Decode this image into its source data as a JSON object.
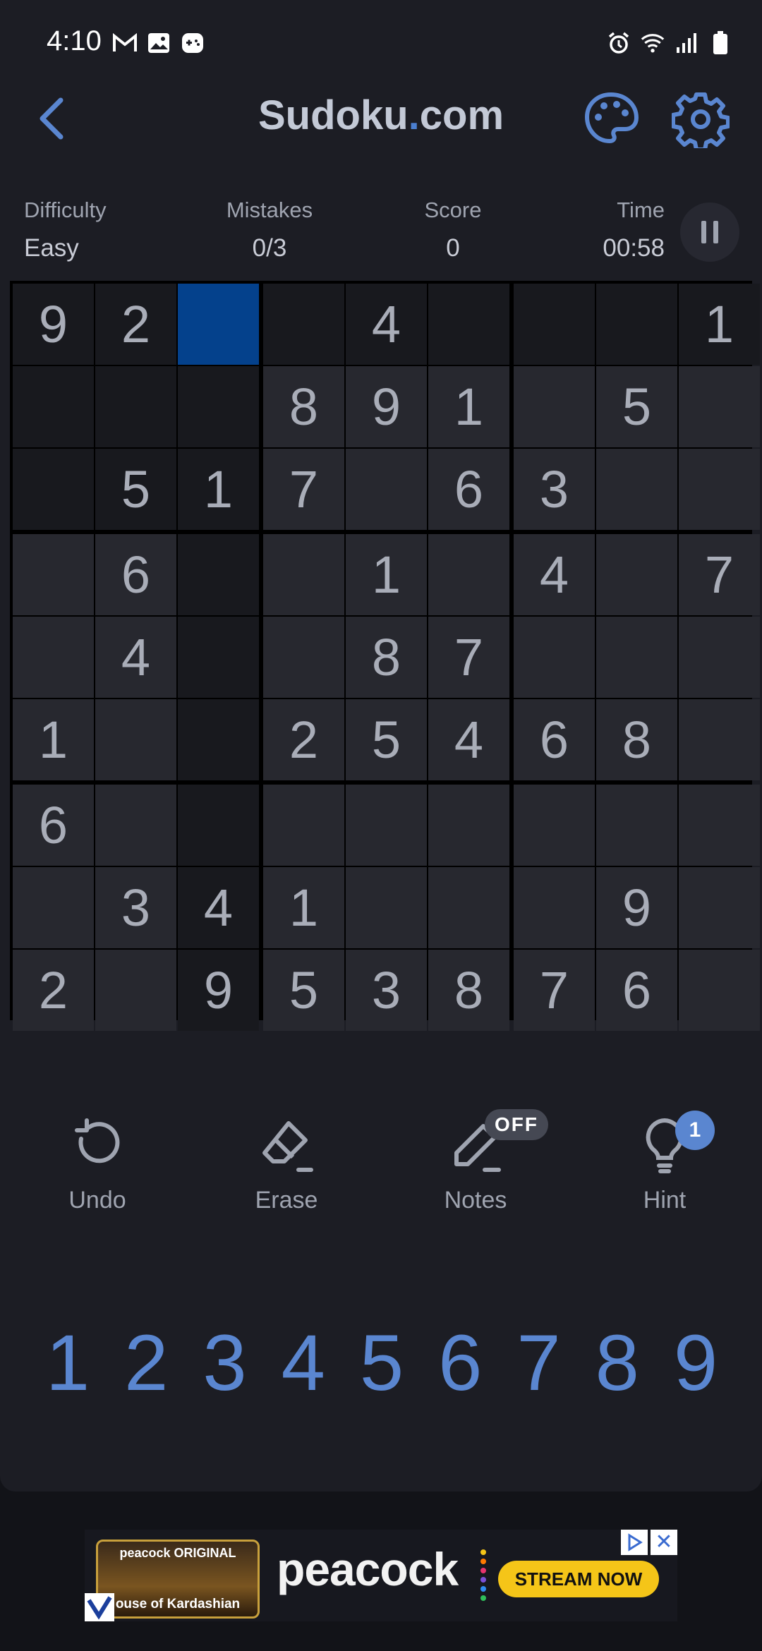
{
  "status_bar": {
    "time": "4:10",
    "left_icons": [
      "gmail-icon",
      "gallery-icon",
      "game-icon"
    ],
    "right_icons": [
      "alarm-icon",
      "wifi-icon",
      "signal-icon",
      "battery-icon"
    ]
  },
  "header": {
    "title_main": "Sudoku",
    "title_dot": ".",
    "title_tld": "com"
  },
  "stats": {
    "difficulty": {
      "label": "Difficulty",
      "value": "Easy"
    },
    "mistakes": {
      "label": "Mistakes",
      "value": "0/3"
    },
    "score": {
      "label": "Score",
      "value": "0"
    },
    "time": {
      "label": "Time",
      "value": "00:58"
    }
  },
  "grid": {
    "selected": [
      0,
      2
    ],
    "rows": [
      [
        "9",
        "2",
        "",
        "",
        "4",
        "",
        "",
        "",
        "1"
      ],
      [
        "",
        "",
        "",
        "8",
        "9",
        "1",
        "",
        "5",
        ""
      ],
      [
        "",
        "5",
        "1",
        "7",
        "",
        "6",
        "3",
        "",
        ""
      ],
      [
        "",
        "6",
        "",
        "",
        "1",
        "",
        "4",
        "",
        "7"
      ],
      [
        "",
        "4",
        "",
        "",
        "8",
        "7",
        "",
        "",
        ""
      ],
      [
        "1",
        "",
        "",
        "2",
        "5",
        "4",
        "6",
        "8",
        ""
      ],
      [
        "6",
        "",
        "",
        "",
        "",
        "",
        "",
        "",
        ""
      ],
      [
        "",
        "3",
        "4",
        "1",
        "",
        "",
        "",
        "9",
        ""
      ],
      [
        "2",
        "",
        "9",
        "5",
        "3",
        "8",
        "7",
        "6",
        ""
      ]
    ]
  },
  "tools": {
    "undo": "Undo",
    "erase": "Erase",
    "notes": "Notes",
    "notes_badge": "OFF",
    "hint": "Hint",
    "hint_badge": "1"
  },
  "numpad": [
    "1",
    "2",
    "3",
    "4",
    "5",
    "6",
    "7",
    "8",
    "9"
  ],
  "ad": {
    "poster_label": "peacock ORIGINAL",
    "poster_title": "ouse of Kardashian",
    "brand": "peacock",
    "cta": "STREAM NOW",
    "close": "✕"
  },
  "colors": {
    "accent": "#5a86d0",
    "selected_cell": "#04418c",
    "background": "#1c1d24"
  }
}
